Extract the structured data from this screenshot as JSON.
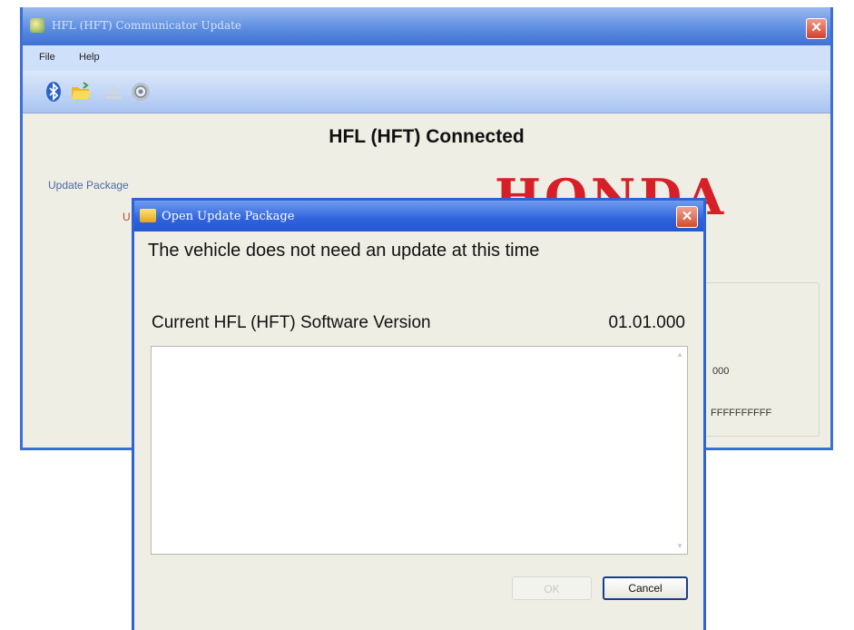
{
  "main_window": {
    "title": "HFL (HFT) Communicator Update",
    "menu": {
      "file": "File",
      "help": "Help"
    },
    "toolbar_icons": [
      "bluetooth-icon",
      "open-folder-icon",
      "eject-icon",
      "settings-gear-icon"
    ],
    "status_heading": "HFL (HFT) Connected",
    "update_package_label": "Update Package",
    "red_label": "U",
    "brand": "HONDA",
    "info_values": [
      "000",
      "FFFFFFFFFF"
    ]
  },
  "dialog": {
    "title": "Open Update Package",
    "message": "The vehicle does not need an update at this time",
    "version_label": "Current HFL (HFT) Software Version",
    "version_value": "01.01.000",
    "details_text": "",
    "ok_label": "OK",
    "cancel_label": "Cancel"
  },
  "colors": {
    "titlebar_blue": "#2f63dc",
    "window_bg": "#efeee4",
    "honda_red": "#d61f26"
  }
}
